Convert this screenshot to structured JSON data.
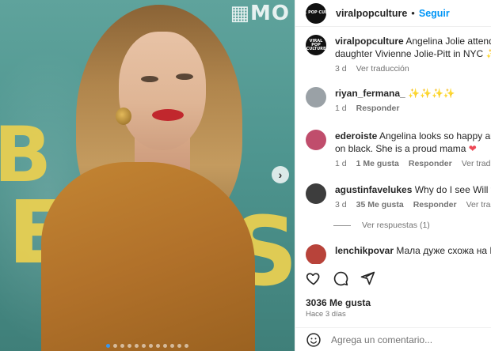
{
  "post": {
    "photo_alt": "",
    "watermark": "▦MO",
    "carousel": {
      "count": 12,
      "active": 0
    }
  },
  "header": {
    "username": "viralpopculture",
    "separator": "•",
    "follow_label": "Seguir",
    "logo_text": "VIRAL POP CULTURE"
  },
  "caption": {
    "username": "viralpopculture",
    "text": "Angelina Jolie attends a",
    "text2": "daughter Vivienne Jolie-Pitt in NYC",
    "emoji": "✨",
    "time": "3 d",
    "translate": "Ver traducción"
  },
  "comments": [
    {
      "username": "riyan_fermana_",
      "text": "✨✨✨✨",
      "time": "1 d",
      "likes": "",
      "reply": "Responder",
      "translate": "",
      "avatar_color": "#9aa1a6"
    },
    {
      "username": "ederoiste",
      "text": "Angelina looks so happy and",
      "text2": "on black. She is a proud mama",
      "heart": "❤",
      "time": "1 d",
      "likes": "1 Me gusta",
      "reply": "Responder",
      "translate": "Ver traducción",
      "avatar_color": "#c04d6c"
    },
    {
      "username": "agustinfavelukes",
      "text": "Why do I see Will from",
      "time": "3 d",
      "likes": "35 Me gusta",
      "reply": "Responder",
      "translate": "Ver traducción",
      "avatar_color": "#3d3d3d"
    },
    {
      "username": "lenchikpovar",
      "text": "Мала дуже схожа на Бред",
      "avatar_color": "#b8433a"
    }
  ],
  "replies_label": "Ver respuestas (1)",
  "actions": {
    "like": "heart-icon",
    "comment": "comment-icon",
    "share": "share-icon"
  },
  "likes": "3036 Me gusta",
  "posted_ago": "Hace 3 días",
  "add_comment": {
    "placeholder": "Agrega un comentario..."
  }
}
